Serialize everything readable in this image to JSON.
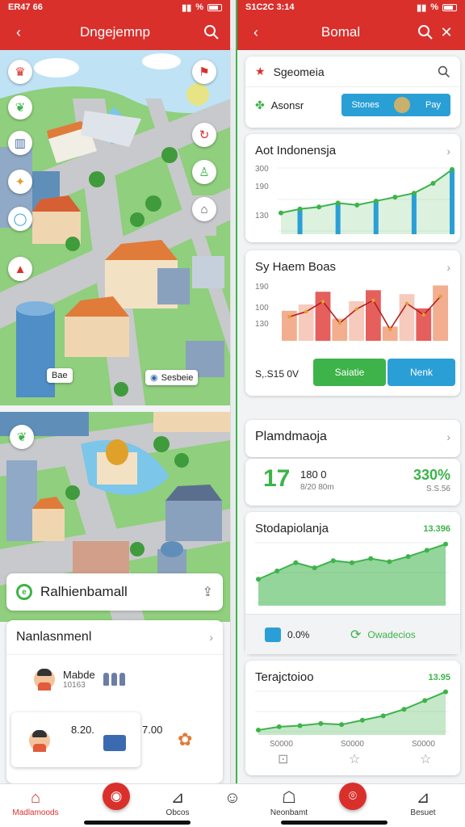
{
  "left": {
    "status": {
      "time": "ER47 66"
    },
    "appbar": {
      "title": "Dngejemnp"
    },
    "map_label": "Sesbeie",
    "map_label_small": "Bae",
    "location": {
      "name": "Ralhienbamall"
    },
    "management": {
      "title": "Nanlasnmenl",
      "row1": {
        "name": "Mabde",
        "sub": "10163"
      },
      "row2": {
        "value": "8.20.",
        "value2": "7.00"
      }
    }
  },
  "right": {
    "status": {
      "time": "S1C2C 3:14"
    },
    "appbar": {
      "title": "Bomal"
    },
    "search": {
      "label": "Sgeomeia"
    },
    "filter": {
      "label": "Asonsr",
      "chip1": "Stones",
      "chip2": "Pay"
    },
    "chart1": {
      "title": "Aot Indonensja",
      "ticks": [
        "300",
        "190",
        "130"
      ]
    },
    "chart2": {
      "title": "Sy Haem Boas",
      "ticks": [
        "190",
        "100",
        "130"
      ],
      "amount": "S,.S15 0V",
      "btn_green": "Saiatie",
      "btn_blue": "Nenk"
    },
    "section": {
      "title": "Plamdmaoja"
    },
    "stats": {
      "big": "17",
      "mid": "180 0",
      "mid_sub": "8/20 80m",
      "pct": "330%",
      "pct_sub": "S.S.56"
    },
    "chart3": {
      "title": "Stodapiolanja",
      "value": "13.396",
      "f1": "0.0%",
      "f2": "Owadecios"
    },
    "chart4": {
      "title": "Terajctoioo",
      "value": "13.95",
      "x": [
        "S0000",
        "S0000",
        "S0000"
      ]
    }
  },
  "nav": {
    "left_home": "Madlamoods",
    "left_2": "Obcos",
    "right_1": "Neonbamt",
    "right_2": "Besuet"
  },
  "chart_data": [
    {
      "type": "area",
      "title": "Aot Indonensja",
      "x": [
        1,
        2,
        3,
        4,
        5,
        6,
        7,
        8,
        9,
        10
      ],
      "values": [
        10,
        12,
        13,
        15,
        14,
        16,
        18,
        20,
        25,
        32
      ]
    },
    {
      "type": "bar",
      "title": "Sy Haem Boas",
      "x": [
        1,
        2,
        3,
        4,
        5,
        6,
        7,
        8,
        9,
        10
      ],
      "values": [
        38,
        46,
        62,
        28,
        50,
        64,
        18,
        59,
        41,
        70
      ]
    },
    {
      "type": "area",
      "title": "Stodapiolanja",
      "x": [
        1,
        2,
        3,
        4,
        5,
        6,
        7,
        8,
        9,
        10,
        11
      ],
      "values": [
        24,
        32,
        40,
        35,
        42,
        40,
        44,
        41,
        46,
        52,
        58
      ]
    },
    {
      "type": "area",
      "title": "Terajctoioo",
      "x": [
        1,
        2,
        3,
        4,
        5,
        6,
        7,
        8,
        9,
        10
      ],
      "values": [
        3,
        6,
        7,
        9,
        8,
        12,
        16,
        22,
        30,
        38
      ]
    }
  ],
  "colors": {
    "red": "#d9302c",
    "green": "#3db34a",
    "blue": "#2a9fd6"
  }
}
